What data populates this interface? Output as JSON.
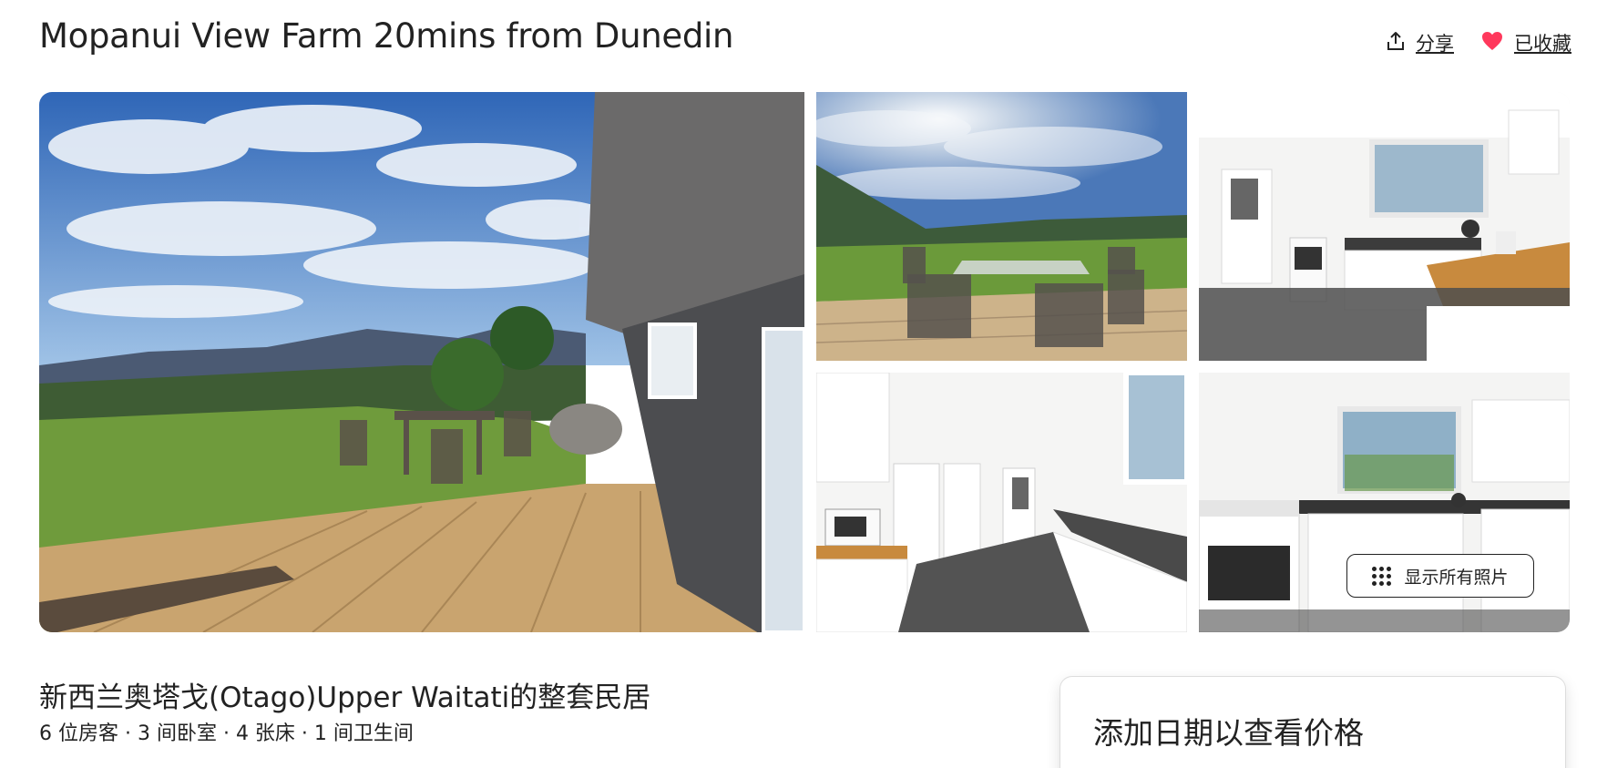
{
  "listing": {
    "title": "Mopanui View Farm 20mins from Dunedin",
    "subtitle": "新西兰奥塔戈(Otago)Upper Waitati的整套民居",
    "details": "6 位房客 · 3 间卧室 · 4 张床 · 1 间卫生间"
  },
  "actions": {
    "share_label": "分享",
    "save_label": "已收藏"
  },
  "gallery": {
    "show_all_label": "显示所有照片",
    "photos": [
      "deck-with-valley-view",
      "deck-table-sunny-sky",
      "kitchen-counter",
      "kitchen-hallway",
      "kitchen-oven"
    ]
  },
  "booking": {
    "prompt": "添加日期以查看价格"
  },
  "colors": {
    "heart": "#ff385c",
    "text": "#222222"
  }
}
